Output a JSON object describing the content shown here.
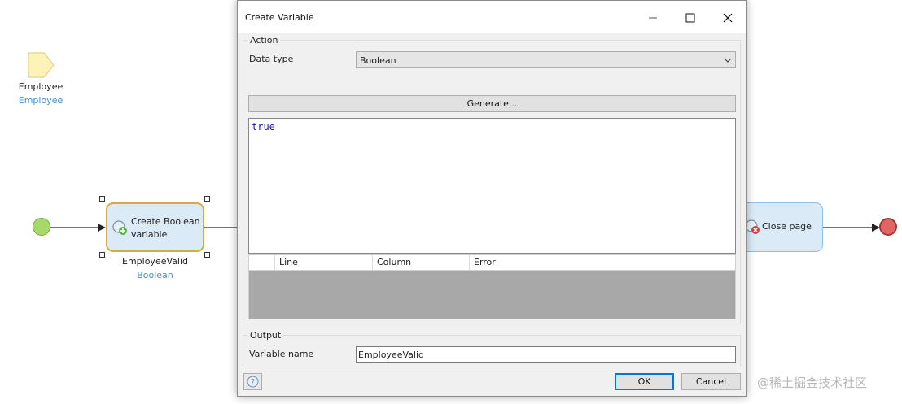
{
  "canvas": {
    "param_name": "Employee",
    "param_type": "Employee",
    "create_action_label_line1": "Create Boolean",
    "create_action_label_line2": "variable",
    "create_output_name": "EmployeeValid",
    "create_output_type": "Boolean",
    "close_page_label": "Close page"
  },
  "dialog": {
    "title": "Create Variable",
    "action_group": "Action",
    "data_type_label": "Data type",
    "data_type_value": "Boolean",
    "generate_button": "Generate...",
    "expression": "true",
    "error_columns": [
      "Line",
      "Column",
      "Error"
    ],
    "output_group": "Output",
    "variable_name_label": "Variable name",
    "variable_name_value": "EmployeeValid",
    "ok_button": "OK",
    "cancel_button": "Cancel"
  },
  "watermark": "@稀土掘金技术社区",
  "colors": {
    "start_event": "#a6d96a",
    "end_event": "#e06666",
    "activity_fill": "#dbeaf7",
    "selected_border": "#d6a94a",
    "flow_line": "#222222",
    "type_text": "#3d8fd6"
  }
}
